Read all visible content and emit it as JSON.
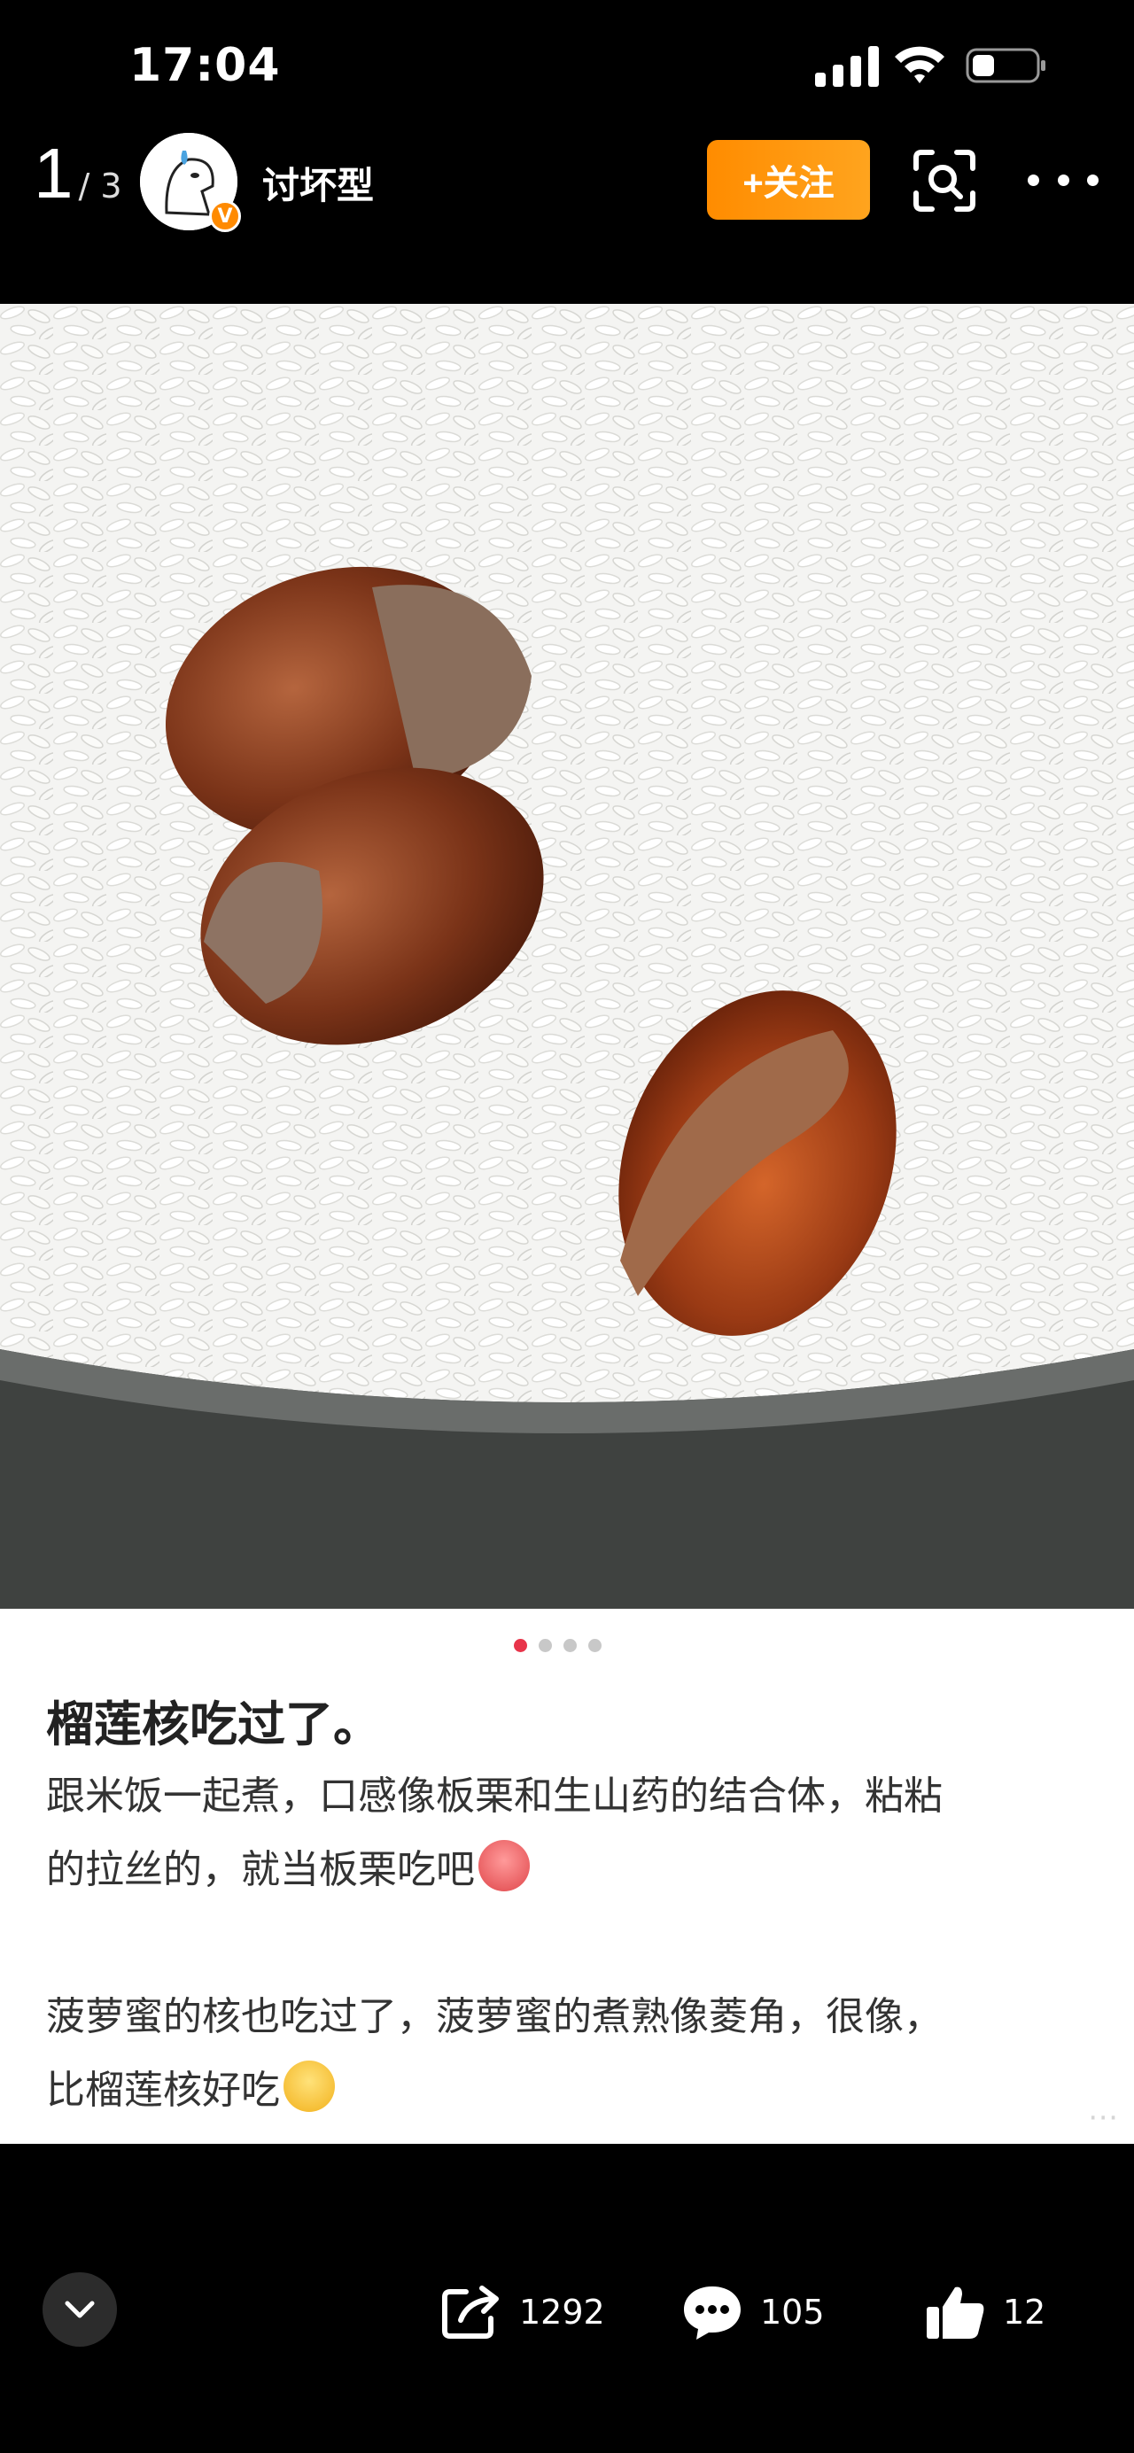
{
  "status_bar": {
    "time": "17:04"
  },
  "header": {
    "page_current": "1",
    "page_total": "/ 3",
    "username": "讨坏型",
    "verified_badge": "V",
    "follow_label": "+关注"
  },
  "photo": {
    "alt": "米饭中煮熟的榴莲核"
  },
  "carousel": {
    "count": 4,
    "active": 0
  },
  "post": {
    "title": "榴莲核吃过了。",
    "paragraph1_line1": "跟米饭一起煮，口感像板栗和生山药的结合体，粘粘",
    "paragraph1_line2": "的拉丝的，就当板栗吃吧",
    "paragraph2_line1": "菠萝蜜的核也吃过了，菠萝蜜的煮熟像菱角，很像，",
    "paragraph2_line2": "比榴莲核好吃"
  },
  "actions": {
    "share_count": "1292",
    "comment_count": "105",
    "like_count": "12"
  },
  "colors": {
    "accent": "#ff8c00",
    "active_dot": "#e8344a"
  }
}
